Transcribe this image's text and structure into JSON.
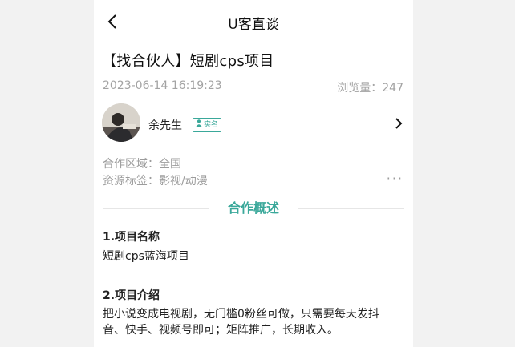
{
  "header": {
    "title": "U客直谈",
    "back_icon": "chevron-left-icon"
  },
  "article": {
    "title": "【找合伙人】短剧cps项目",
    "date": "2023-06-14 16:19:23",
    "views": "浏览量：247"
  },
  "author": {
    "name": "余先生",
    "badge": "实名",
    "badge_icon": "person-icon",
    "arrow_icon": "chevron-right-icon"
  },
  "info": {
    "region": "合作区域：全国",
    "tags": "资源标签：影视/动漫",
    "more": "···"
  },
  "overview": {
    "title": "合作概述",
    "sections": [
      {
        "heading": "1.项目名称",
        "body": "短剧cps蓝海项目"
      },
      {
        "heading": "2.项目介绍",
        "body": "把小说变成电视剧，无门槛0粉丝可做，只需要每天发抖音、快手、视频号即可；矩阵推广，长期收入。"
      }
    ]
  },
  "colors": {
    "accent": "#3aa89a",
    "muted_text": "#a3a3a3",
    "primary_text": "#111111"
  }
}
